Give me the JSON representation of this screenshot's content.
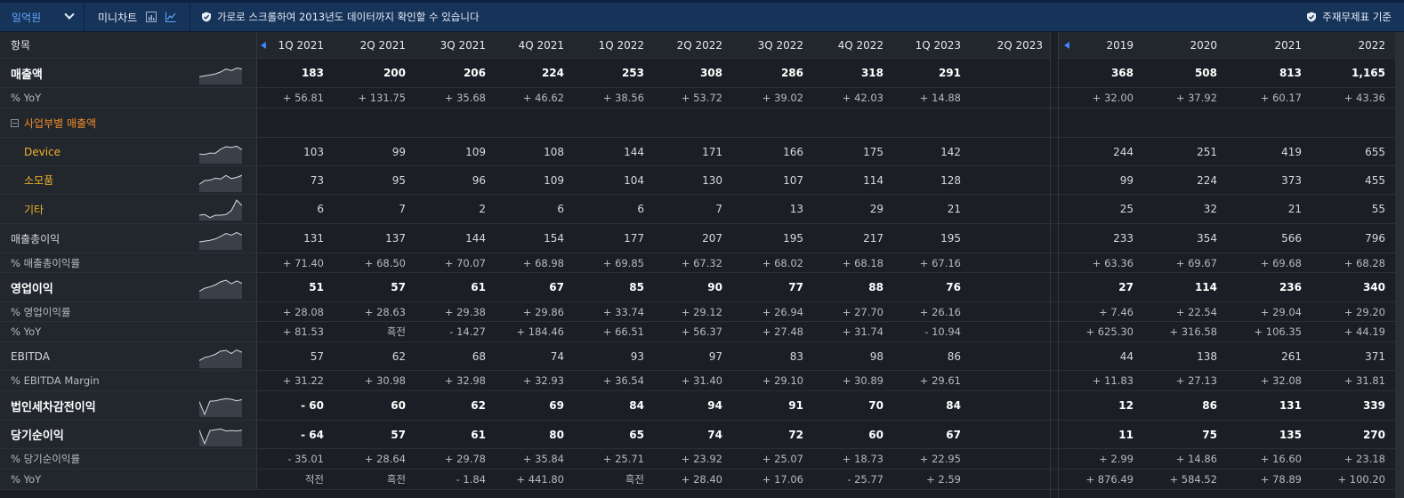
{
  "toolbar": {
    "unit": "일억원",
    "mini_chart": "미니차트",
    "notice": "가로로 스크롤하여 2013년도 데이터까지 확인할 수 있습니다",
    "basis": "주재무제표 기준"
  },
  "header": {
    "item": "항목",
    "quarters": [
      "1Q 2021",
      "2Q 2021",
      "3Q 2021",
      "4Q 2021",
      "1Q 2022",
      "2Q 2022",
      "3Q 2022",
      "4Q 2022",
      "1Q 2023",
      "2Q 2023"
    ],
    "years": [
      "2019",
      "2020",
      "2021",
      "2022"
    ]
  },
  "rows": [
    {
      "label": "매출액",
      "style": "bold",
      "spark": [
        0.3,
        0.35,
        0.4,
        0.45,
        0.55,
        0.7,
        0.62,
        0.75,
        0.7
      ],
      "q": [
        "183",
        "200",
        "206",
        "224",
        "253",
        "308",
        "286",
        "318",
        "291",
        ""
      ],
      "y": [
        "368",
        "508",
        "813",
        "1,165"
      ]
    },
    {
      "label": "% YoY",
      "style": "pct",
      "q": [
        "+ 56.81",
        "+ 131.75",
        "+ 35.68",
        "+ 46.62",
        "+ 38.56",
        "+ 53.72",
        "+ 39.02",
        "+ 42.03",
        "+ 14.88",
        ""
      ],
      "y": [
        "+ 32.00",
        "+ 37.92",
        "+ 60.17",
        "+ 43.36"
      ]
    },
    {
      "label": "사업부별 매출액",
      "style": "group",
      "q": [
        "",
        "",
        "",
        "",
        "",
        "",
        "",
        "",
        "",
        ""
      ],
      "y": [
        "",
        "",
        "",
        ""
      ]
    },
    {
      "label": "Device",
      "style": "child",
      "spark": [
        0.4,
        0.38,
        0.45,
        0.44,
        0.65,
        0.78,
        0.74,
        0.8,
        0.62
      ],
      "q": [
        "103",
        "99",
        "109",
        "108",
        "144",
        "171",
        "166",
        "175",
        "142",
        ""
      ],
      "y": [
        "244",
        "251",
        "419",
        "655"
      ]
    },
    {
      "label": "소모품",
      "style": "child",
      "spark": [
        0.3,
        0.5,
        0.52,
        0.62,
        0.58,
        0.76,
        0.6,
        0.66,
        0.76
      ],
      "q": [
        "73",
        "95",
        "96",
        "109",
        "104",
        "130",
        "107",
        "114",
        "128",
        ""
      ],
      "y": [
        "99",
        "224",
        "373",
        "455"
      ]
    },
    {
      "label": "기타",
      "style": "child",
      "spark": [
        0.18,
        0.22,
        0.06,
        0.18,
        0.18,
        0.22,
        0.42,
        0.95,
        0.68
      ],
      "q": [
        "6",
        "7",
        "2",
        "6",
        "6",
        "7",
        "13",
        "29",
        "21",
        ""
      ],
      "y": [
        "25",
        "32",
        "21",
        "55"
      ]
    },
    {
      "label": "매출총이익",
      "style": "normal",
      "spark": [
        0.32,
        0.36,
        0.4,
        0.47,
        0.6,
        0.75,
        0.66,
        0.8,
        0.66
      ],
      "q": [
        "131",
        "137",
        "144",
        "154",
        "177",
        "207",
        "195",
        "217",
        "195",
        ""
      ],
      "y": [
        "233",
        "354",
        "566",
        "796"
      ]
    },
    {
      "label": "% 매출총이익률",
      "style": "pct",
      "q": [
        "+ 71.40",
        "+ 68.50",
        "+ 70.07",
        "+ 68.98",
        "+ 69.85",
        "+ 67.32",
        "+ 68.02",
        "+ 68.18",
        "+ 67.16",
        ""
      ],
      "y": [
        "+ 63.36",
        "+ 69.67",
        "+ 69.68",
        "+ 68.28"
      ]
    },
    {
      "label": "영업이익",
      "style": "bold",
      "spark": [
        0.3,
        0.45,
        0.52,
        0.62,
        0.78,
        0.86,
        0.68,
        0.82,
        0.7
      ],
      "q": [
        "51",
        "57",
        "61",
        "67",
        "85",
        "90",
        "77",
        "88",
        "76",
        ""
      ],
      "y": [
        "27",
        "114",
        "236",
        "340"
      ]
    },
    {
      "label": "% 영업이익률",
      "style": "pct",
      "q": [
        "+ 28.08",
        "+ 28.63",
        "+ 29.38",
        "+ 29.86",
        "+ 33.74",
        "+ 29.12",
        "+ 26.94",
        "+ 27.70",
        "+ 26.16",
        ""
      ],
      "y": [
        "+ 7.46",
        "+ 22.54",
        "+ 29.04",
        "+ 29.20"
      ]
    },
    {
      "label": "% YoY",
      "style": "pct",
      "q": [
        "+ 81.53",
        "흑전",
        "- 14.27",
        "+ 184.46",
        "+ 66.51",
        "+ 56.37",
        "+ 27.48",
        "+ 31.74",
        "- 10.94",
        ""
      ],
      "y": [
        "+ 625.30",
        "+ 316.58",
        "+ 106.35",
        "+ 44.19"
      ]
    },
    {
      "label": "EBITDA",
      "style": "normal",
      "spark": [
        0.3,
        0.45,
        0.52,
        0.62,
        0.78,
        0.82,
        0.66,
        0.84,
        0.72
      ],
      "q": [
        "57",
        "62",
        "68",
        "74",
        "93",
        "97",
        "83",
        "98",
        "86",
        ""
      ],
      "y": [
        "44",
        "138",
        "261",
        "371"
      ]
    },
    {
      "label": "% EBITDA Margin",
      "style": "pct",
      "q": [
        "+ 31.22",
        "+ 30.98",
        "+ 32.98",
        "+ 32.93",
        "+ 36.54",
        "+ 31.40",
        "+ 29.10",
        "+ 30.89",
        "+ 29.61",
        ""
      ],
      "y": [
        "+ 11.83",
        "+ 27.13",
        "+ 32.08",
        "+ 31.81"
      ]
    },
    {
      "label": "법인세차감전이익",
      "style": "bold",
      "spark": [
        0.7,
        0.05,
        0.72,
        0.74,
        0.8,
        0.85,
        0.82,
        0.74,
        0.8
      ],
      "q": [
        "- 60",
        "60",
        "62",
        "69",
        "84",
        "94",
        "91",
        "70",
        "84",
        ""
      ],
      "y": [
        "12",
        "86",
        "131",
        "339"
      ]
    },
    {
      "label": "당기순이익",
      "style": "bold",
      "spark": [
        0.75,
        0.05,
        0.72,
        0.76,
        0.8,
        0.7,
        0.72,
        0.7,
        0.74
      ],
      "q": [
        "- 64",
        "57",
        "61",
        "80",
        "65",
        "74",
        "72",
        "60",
        "67",
        ""
      ],
      "y": [
        "11",
        "75",
        "135",
        "270"
      ]
    },
    {
      "label": "% 당기순이익률",
      "style": "pct",
      "q": [
        "- 35.01",
        "+ 28.64",
        "+ 29.78",
        "+ 35.84",
        "+ 25.71",
        "+ 23.92",
        "+ 25.07",
        "+ 18.73",
        "+ 22.95",
        ""
      ],
      "y": [
        "+ 2.99",
        "+ 14.86",
        "+ 16.60",
        "+ 23.18"
      ]
    },
    {
      "label": "% YoY",
      "style": "pct",
      "q": [
        "적전",
        "흑전",
        "- 1.84",
        "+ 441.80",
        "흑전",
        "+ 28.40",
        "+ 17.06",
        "- 25.77",
        "+ 2.59",
        ""
      ],
      "y": [
        "+ 876.49",
        "+ 584.52",
        "+ 78.89",
        "+ 100.20"
      ]
    }
  ]
}
